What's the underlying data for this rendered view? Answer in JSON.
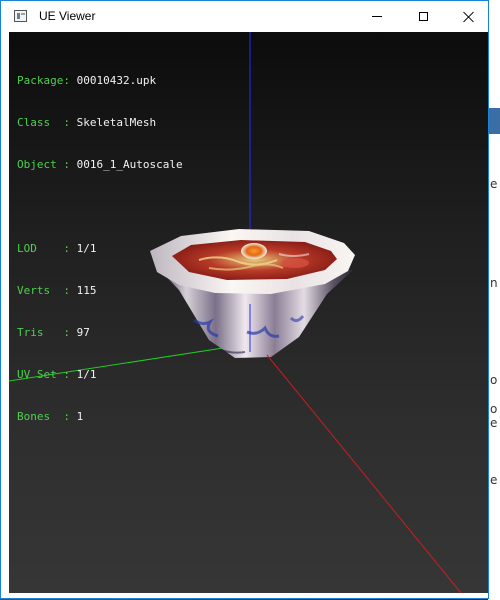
{
  "window": {
    "title": "UE Viewer",
    "buttons": {
      "minimize": "minimize",
      "maximize": "maximize",
      "close": "close"
    }
  },
  "info": {
    "package": {
      "label": "Package:",
      "value": "00010432.upk"
    },
    "class": {
      "label": "Class  :",
      "value": "SkeletalMesh"
    },
    "object": {
      "label": "Object :",
      "value": "0016_1_Autoscale"
    },
    "lod": {
      "label": "LOD    :",
      "value": "1/1"
    },
    "verts": {
      "label": "Verts  :",
      "value": "115"
    },
    "tris": {
      "label": "Tris   :",
      "value": "97"
    },
    "uvset": {
      "label": "UV Set :",
      "value": "1/1"
    },
    "bones": {
      "label": "Bones  :",
      "value": "1"
    }
  },
  "background_glyphs": [
    "e",
    "n",
    "o",
    "o",
    "e",
    "e"
  ],
  "colors": {
    "label_green": "#4ed04e",
    "value_white": "#f2f2f2",
    "axis_x": "#c81e1e",
    "axis_y": "#22cc22",
    "axis_z": "#2a2aff",
    "window_border": "#1883d7"
  },
  "icons": {
    "app": "app-window-icon",
    "minimize": "minimize-icon",
    "maximize": "maximize-icon",
    "close": "close-icon"
  }
}
